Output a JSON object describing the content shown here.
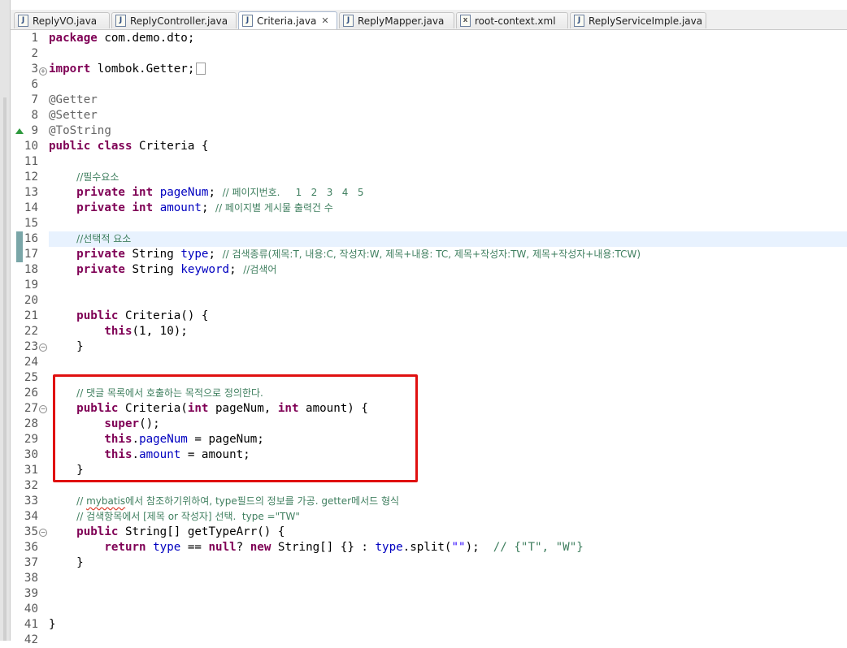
{
  "tabs": [
    {
      "label": "ReplyVO.java",
      "icon": "java-file-icon",
      "active": false
    },
    {
      "label": "ReplyController.java",
      "icon": "java-file-icon",
      "active": false
    },
    {
      "label": "Criteria.java",
      "icon": "java-file-icon",
      "active": true
    },
    {
      "label": "ReplyMapper.java",
      "icon": "java-file-icon",
      "active": false
    },
    {
      "label": "root-context.xml",
      "icon": "xml-file-icon",
      "active": false
    },
    {
      "label": "ReplyServiceImple.java",
      "icon": "java-file-icon",
      "active": false
    }
  ],
  "editor": {
    "file": "Criteria.java",
    "current_line": 16,
    "lines": [
      {
        "n": "1"
      },
      {
        "n": "2"
      },
      {
        "n": "3"
      },
      {
        "n": "6"
      },
      {
        "n": "7"
      },
      {
        "n": "8"
      },
      {
        "n": "9"
      },
      {
        "n": "10"
      },
      {
        "n": "11"
      },
      {
        "n": "12"
      },
      {
        "n": "13"
      },
      {
        "n": "14"
      },
      {
        "n": "15"
      },
      {
        "n": "16"
      },
      {
        "n": "17"
      },
      {
        "n": "18"
      },
      {
        "n": "19"
      },
      {
        "n": "20"
      },
      {
        "n": "21"
      },
      {
        "n": "22"
      },
      {
        "n": "23"
      },
      {
        "n": "24"
      },
      {
        "n": "25"
      },
      {
        "n": "26"
      },
      {
        "n": "27"
      },
      {
        "n": "28"
      },
      {
        "n": "29"
      },
      {
        "n": "30"
      },
      {
        "n": "31"
      },
      {
        "n": "32"
      },
      {
        "n": "33"
      },
      {
        "n": "34"
      },
      {
        "n": "35"
      },
      {
        "n": "36"
      },
      {
        "n": "37"
      },
      {
        "n": "38"
      },
      {
        "n": "39"
      },
      {
        "n": "40"
      },
      {
        "n": "41"
      },
      {
        "n": "42"
      }
    ],
    "code": {
      "l1_kw": "package",
      "l1_rest": " com.demo.dto;",
      "l3_kw": "import",
      "l3_rest": " lombok.Getter;",
      "l7": "@Getter",
      "l8": "@Setter",
      "l9": "@ToString",
      "l10_kw": "public class",
      "l10_rest": " Criteria {",
      "l12": "//필수요소",
      "l13_kw": "private int",
      "l13_fld": "pageNum",
      "l13_semi": "; ",
      "l13_cm": "// 페이지번호.     1   2   3   4   5",
      "l14_kw": "private int",
      "l14_fld": "amount",
      "l14_semi": "; ",
      "l14_cm": "// 페이지별 게시물 출력건 수",
      "l16": "//선택적 요소",
      "l17_kw": "private",
      "l17_type": " String ",
      "l17_fld": "type",
      "l17_semi": "; ",
      "l17_cm": "// 검색종류(제목:T, 내용:C, 작성자:W, 제목+내용: TC, 제목+작성자:TW, 제목+작성자+내용:TCW)",
      "l18_kw": "private",
      "l18_type": " String ",
      "l18_fld": "keyword",
      "l18_semi": "; ",
      "l18_cm": "//검색어",
      "l21_kw": "public",
      "l21_rest": " Criteria() {",
      "l22_kw": "this",
      "l22_rest": "(1, 10);",
      "l23": "}",
      "l26": "// 댓글 목록에서 호출하는 목적으로 정의한다.",
      "l27_kw": "public",
      "l27_a": " Criteria(",
      "l27_kw2": "int",
      "l27_b": " pageNum, ",
      "l27_kw3": "int",
      "l27_c": " amount) {",
      "l28_kw": "super",
      "l28_rest": "();",
      "l29_kw": "this",
      "l29_dot": ".",
      "l29_fld": "pageNum",
      "l29_rest": " = pageNum;",
      "l30_kw": "this",
      "l30_dot": ".",
      "l30_fld": "amount",
      "l30_rest": " = amount;",
      "l31": "}",
      "l33_a": "// ",
      "l33_sq": "mybatis",
      "l33_b": "에서 참조하기위하여, type필드의 정보를 가공. getter메서드 형식",
      "l34": "// 검색항목에서 [제목 or 작성자] 선택.  type =\"TW\"",
      "l35_kw": "public",
      "l35_rest": " String[] getTypeArr() {",
      "l36_kw": "return",
      "l36_sp": " ",
      "l36_fld": "type",
      "l36_a": " == ",
      "l36_kw2": "null",
      "l36_b": "? ",
      "l36_kw3": "new",
      "l36_c": " String[] {} : ",
      "l36_fld2": "type",
      "l36_d": ".split(",
      "l36_str": "\"\"",
      "l36_e": ");  ",
      "l36_cm": "// {\"T\", \"W\"}",
      "l37": "}",
      "l41": "}"
    }
  }
}
